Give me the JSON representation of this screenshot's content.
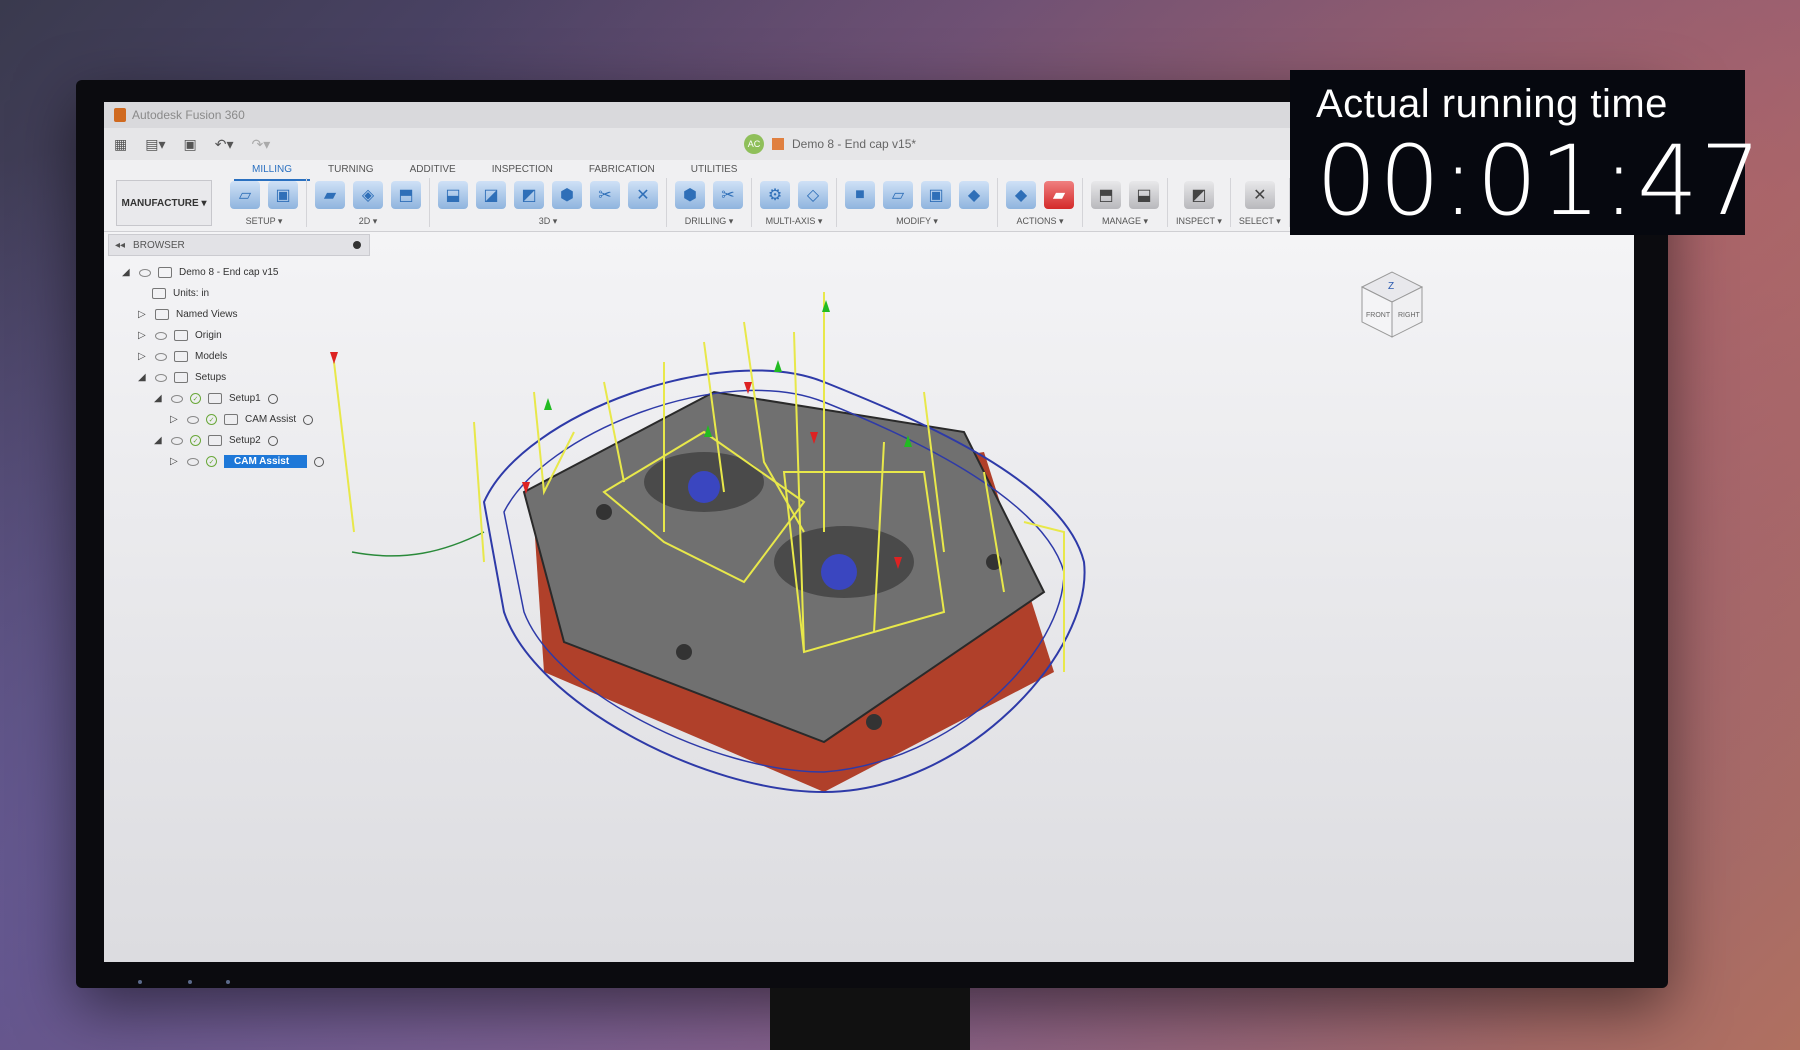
{
  "window": {
    "app_title": "Autodesk Fusion 360",
    "document_title": "Demo 8 - End cap v15*",
    "avatar_initials": "AC"
  },
  "ribbon": {
    "workspace": "MANUFACTURE ▾",
    "tabs": [
      "MILLING",
      "TURNING",
      "ADDITIVE",
      "INSPECTION",
      "FABRICATION",
      "UTILITIES"
    ],
    "active_tab": "MILLING",
    "groups": [
      {
        "label": "SETUP ▾",
        "icons": 2
      },
      {
        "label": "2D ▾",
        "icons": 3
      },
      {
        "label": "3D ▾",
        "icons": 6
      },
      {
        "label": "DRILLING ▾",
        "icons": 2
      },
      {
        "label": "MULTI-AXIS ▾",
        "icons": 2
      },
      {
        "label": "MODIFY ▾",
        "icons": 4
      },
      {
        "label": "ACTIONS ▾",
        "icons": 2
      },
      {
        "label": "MANAGE ▾",
        "icons": 2
      },
      {
        "label": "INSPECT ▾",
        "icons": 1
      },
      {
        "label": "SELECT ▾",
        "icons": 1
      }
    ]
  },
  "browser": {
    "header": "BROWSER",
    "tree": [
      {
        "label": "Demo 8 - End cap v15",
        "level": 0
      },
      {
        "label": "Units: in",
        "level": 1
      },
      {
        "label": "Named Views",
        "level": 1
      },
      {
        "label": "Origin",
        "level": 1
      },
      {
        "label": "Models",
        "level": 1
      },
      {
        "label": "Setups",
        "level": 1
      },
      {
        "label": "Setup1",
        "level": 2
      },
      {
        "label": "CAM Assist",
        "level": 3
      },
      {
        "label": "Setup2",
        "level": 2
      },
      {
        "label": "CAM Assist",
        "level": 3,
        "selected": true
      }
    ]
  },
  "viewcube": {
    "labels": [
      "FRONT",
      "RIGHT",
      "Z"
    ]
  },
  "overlay": {
    "label": "Actual running time",
    "time": "00:01:47"
  },
  "colors": {
    "part_body": "#b0402a",
    "part_top": "#6e6e6e",
    "toolpath_yellow": "#e8e84a",
    "toolpath_blue": "#2e3aa8",
    "selection_blue": "#1e78d8"
  }
}
